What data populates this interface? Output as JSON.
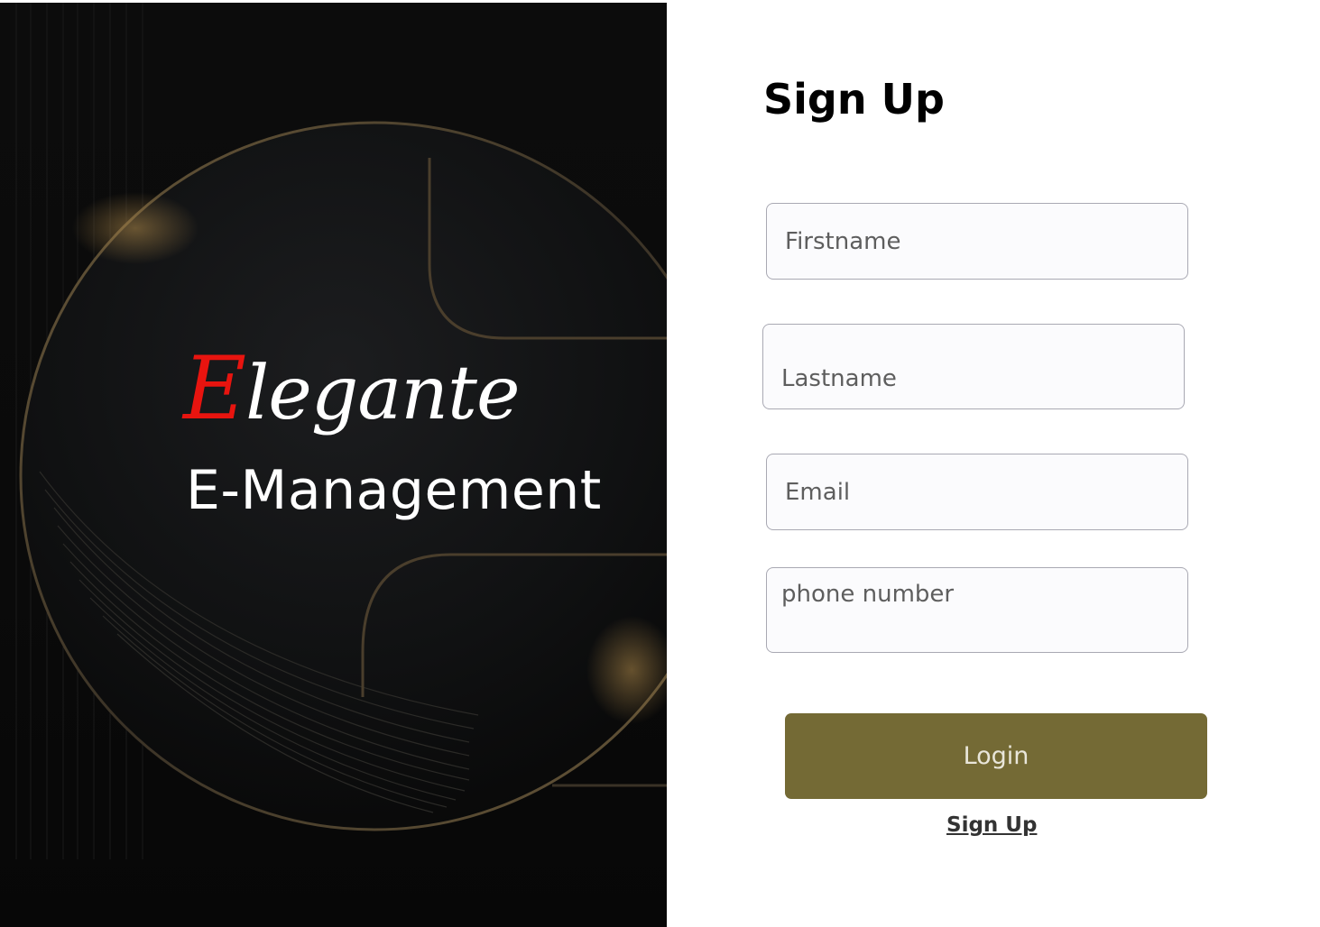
{
  "hero": {
    "brand_initial": "E",
    "brand_rest": "legante",
    "brand_subtitle": "E-Management"
  },
  "form": {
    "title": "Sign Up",
    "fields": {
      "firstname": {
        "placeholder": "Firstname"
      },
      "lastname": {
        "placeholder": "Lastname"
      },
      "email": {
        "placeholder": "Email"
      },
      "phone": {
        "placeholder": "phone number"
      }
    },
    "login_label": "Login",
    "signup_link": "Sign Up"
  },
  "colors": {
    "brand_accent": "#e8140f",
    "button_background": "#746a35",
    "hero_background": "#0a0a0a"
  }
}
